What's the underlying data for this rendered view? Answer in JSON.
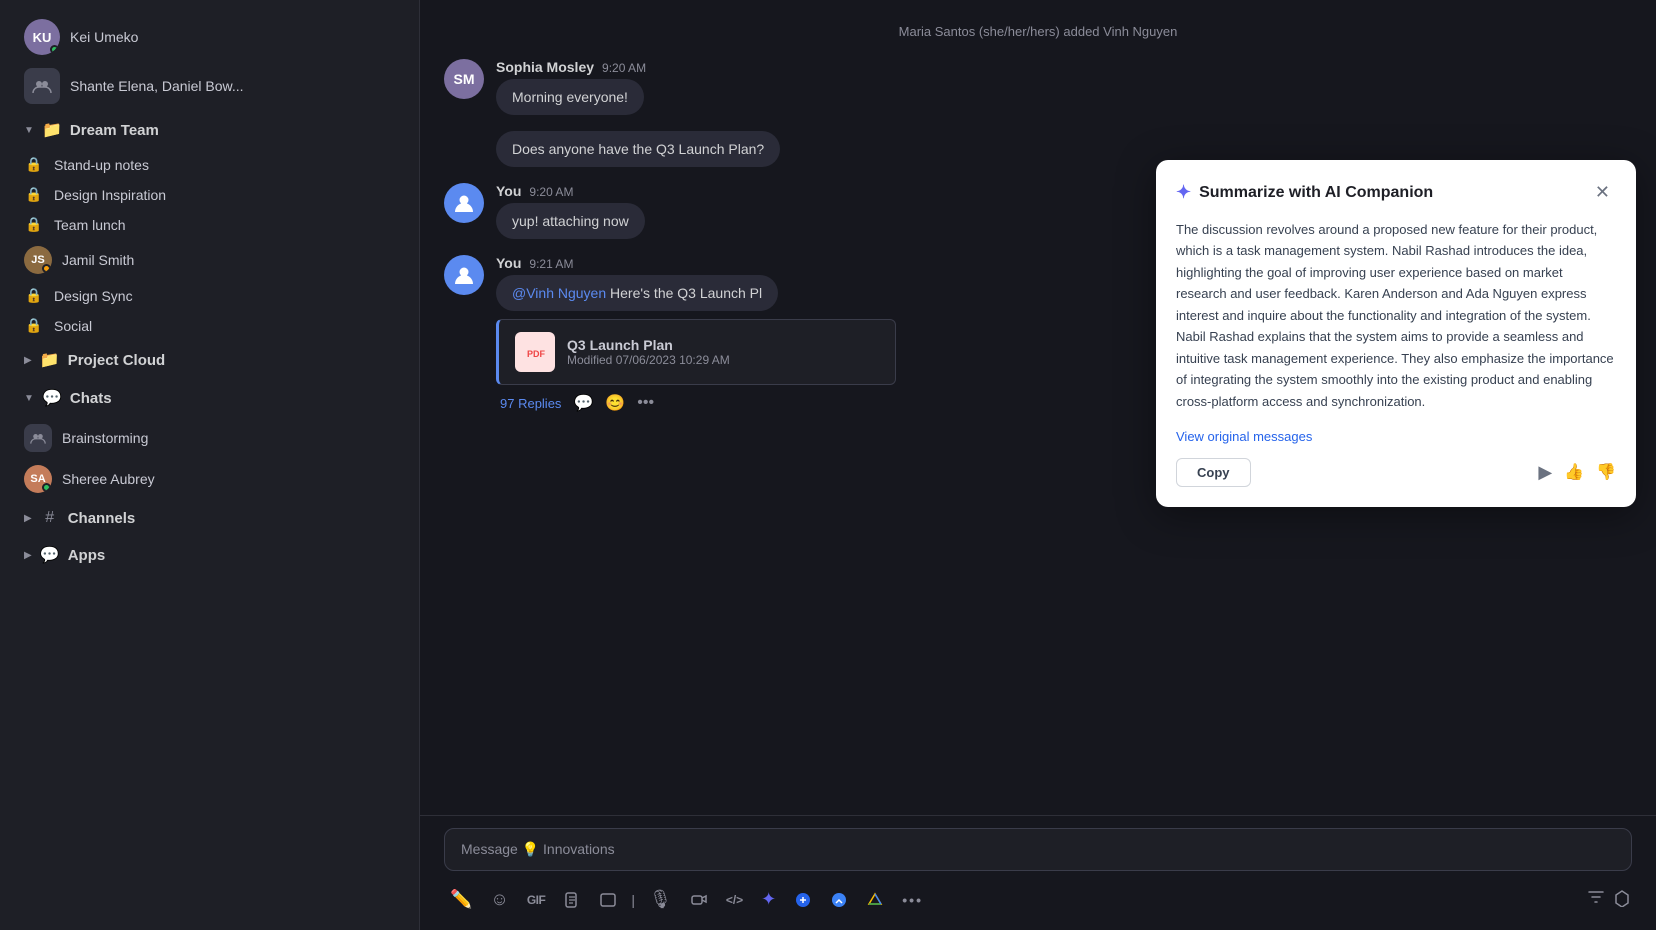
{
  "sidebar": {
    "items_top": [
      {
        "id": "kei-umeko",
        "type": "avatar-user",
        "label": "Kei Umeko",
        "online": true,
        "avatarColor": "#7c6fa0",
        "initials": "KU"
      },
      {
        "id": "shante-group",
        "type": "group",
        "label": "Shante Elena, Daniel Bow..."
      }
    ],
    "dream_team": {
      "label": "Dream Team",
      "expanded": true,
      "channels": [
        {
          "id": "stand-up-notes",
          "label": "Stand-up notes",
          "locked": true
        },
        {
          "id": "design-inspiration",
          "label": "Design Inspiration",
          "locked": true
        },
        {
          "id": "team-lunch",
          "label": "Team lunch",
          "locked": true
        },
        {
          "id": "jamil-smith",
          "label": "Jamil Smith",
          "type": "avatar-user",
          "online": true,
          "avatarColor": "#8b6a40",
          "initials": "JS"
        },
        {
          "id": "design-sync",
          "label": "Design Sync",
          "locked": true
        },
        {
          "id": "social",
          "label": "Social",
          "locked": true
        }
      ]
    },
    "project_cloud": {
      "label": "Project Cloud",
      "expanded": false
    },
    "chats": {
      "label": "Chats",
      "expanded": true,
      "items": [
        {
          "id": "brainstorming",
          "label": "Brainstorming",
          "type": "group"
        },
        {
          "id": "sheree-aubrey",
          "label": "Sheree Aubrey",
          "type": "avatar-user",
          "online": true,
          "avatarColor": "#c47c5a",
          "initials": "SA"
        }
      ]
    },
    "channels": {
      "label": "Channels",
      "expanded": false
    },
    "apps": {
      "label": "Apps",
      "expanded": false
    }
  },
  "chat": {
    "channel_name": "Innovations",
    "system_message": "Maria Santos (she/her/hers) added Vinh Nguyen",
    "messages": [
      {
        "id": "msg1",
        "author": "Sophia Mosley",
        "time": "9:20 AM",
        "text": "Morning everyone!",
        "avatarColor": "#7c6fa0",
        "initials": "SM"
      },
      {
        "id": "msg2",
        "author": null,
        "time": null,
        "text": "Does anyone have the Q3 Launch Plan?",
        "isQuestion": true
      },
      {
        "id": "msg3",
        "author": "You",
        "time": "9:20 AM",
        "text": "yup! attaching now",
        "avatarColor": "#5b8af0",
        "initials": "Y"
      },
      {
        "id": "msg4",
        "author": "You",
        "time": "9:21 AM",
        "mention": "@Vinh Nguyen",
        "text": " Here's the Q3 Launch Pl",
        "avatarColor": "#5b8af0",
        "initials": "Y",
        "attachment": {
          "name": "Q3 Launch Plan",
          "meta": "Modified 07/06/2023 10:29 AM"
        },
        "replies": "97 Replies"
      }
    ],
    "input_placeholder": "Message 💡 Innovations"
  },
  "ai_companion": {
    "title": "Summarize with AI Companion",
    "star_icon": "✦",
    "body": "The discussion revolves around a proposed new feature for their product, which is a task management system. Nabil Rashad introduces the idea, highlighting the goal of improving user experience based on market research and user feedback. Karen Anderson and Ada Nguyen express interest and inquire about the functionality and integration of the system. Nabil Rashad explains that the system aims to provide a seamless and intuitive task management experience. They also emphasize the importance of integrating the system smoothly into the existing product and enabling cross-platform access and synchronization.",
    "view_original_label": "View original messages",
    "copy_label": "Copy"
  },
  "toolbar": {
    "items": [
      {
        "id": "edit",
        "icon": "✏",
        "label": "Edit"
      },
      {
        "id": "emoji",
        "icon": "☺",
        "label": "Emoji"
      },
      {
        "id": "gif",
        "icon": "GIF",
        "label": "GIF"
      },
      {
        "id": "file",
        "icon": "📄",
        "label": "File"
      },
      {
        "id": "format",
        "icon": "⊡",
        "label": "Format"
      },
      {
        "id": "mic",
        "icon": "🎙",
        "label": "Microphone"
      },
      {
        "id": "video",
        "icon": "📹",
        "label": "Video"
      },
      {
        "id": "code",
        "icon": "</>",
        "label": "Code"
      },
      {
        "id": "ai",
        "icon": "✦",
        "label": "AI"
      },
      {
        "id": "zoom",
        "icon": "🔵",
        "label": "Zoom"
      },
      {
        "id": "settings",
        "icon": "⚙",
        "label": "Settings"
      },
      {
        "id": "drive",
        "icon": "△",
        "label": "Drive"
      },
      {
        "id": "more",
        "icon": "•••",
        "label": "More"
      }
    ]
  }
}
